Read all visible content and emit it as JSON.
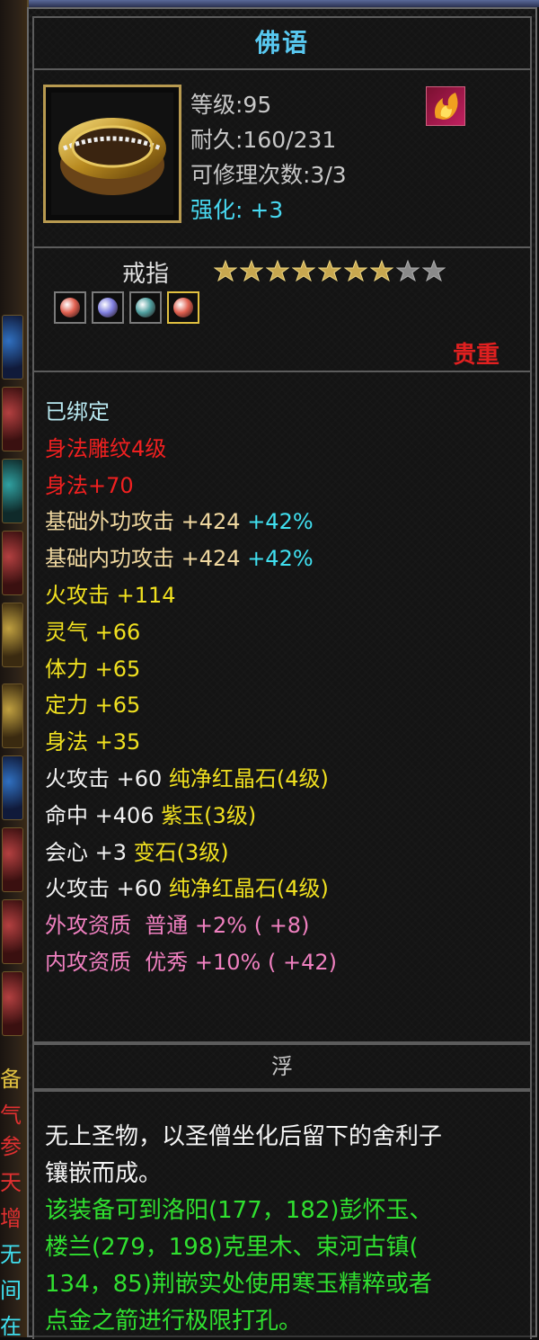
{
  "item": {
    "name": "佛语",
    "icon": "gold-ring-icon",
    "stats": {
      "level": "等级:95",
      "durability": "耐久:160/231",
      "repairs": "可修理次数:3/3",
      "strengthen_label": "强化:",
      "strengthen_value": "+3"
    },
    "badge_icon": "fire-element-icon",
    "type": "戒指",
    "stars": {
      "filled": 7,
      "total": 9
    },
    "gem_slots": [
      {
        "icon": "red-gem-icon",
        "color": "#e06050"
      },
      {
        "icon": "purple-gem-icon",
        "color": "#8080e0"
      },
      {
        "icon": "teal-gem-icon",
        "color": "#50a0a0"
      },
      {
        "icon": "red-gem-icon",
        "color": "#e06050"
      }
    ],
    "rarity": "贵重"
  },
  "attributes": [
    {
      "segs": [
        {
          "t": "已绑定",
          "c": "lightblue"
        }
      ]
    },
    {
      "segs": [
        {
          "t": "身法雕纹4级",
          "c": "red"
        }
      ]
    },
    {
      "segs": [
        {
          "t": "身法+70",
          "c": "red"
        }
      ]
    },
    {
      "segs": [
        {
          "t": "基础外功攻击 +424 ",
          "c": "orange"
        },
        {
          "t": "+42%",
          "c": "cyan"
        }
      ]
    },
    {
      "segs": [
        {
          "t": "基础内功攻击 +424 ",
          "c": "orange"
        },
        {
          "t": "+42%",
          "c": "cyan"
        }
      ]
    },
    {
      "segs": [
        {
          "t": "火攻击 +114",
          "c": "yellow"
        }
      ]
    },
    {
      "segs": [
        {
          "t": "灵气 +66",
          "c": "yellow"
        }
      ]
    },
    {
      "segs": [
        {
          "t": "体力 +65",
          "c": "yellow"
        }
      ]
    },
    {
      "segs": [
        {
          "t": "定力 +65",
          "c": "yellow"
        }
      ]
    },
    {
      "segs": [
        {
          "t": "身法 +35",
          "c": "yellow"
        }
      ]
    },
    {
      "segs": [
        {
          "t": "火攻击 +60 ",
          "c": "white"
        },
        {
          "t": "纯净红晶石(4级)",
          "c": "yellow"
        }
      ]
    },
    {
      "segs": [
        {
          "t": "命中 +406 ",
          "c": "white"
        },
        {
          "t": "紫玉(3级)",
          "c": "yellow"
        }
      ]
    },
    {
      "segs": [
        {
          "t": "会心 +3 ",
          "c": "white"
        },
        {
          "t": "变石(3级)",
          "c": "yellow"
        }
      ]
    },
    {
      "segs": [
        {
          "t": "火攻击 +60 ",
          "c": "white"
        },
        {
          "t": "纯净红晶石(4级)",
          "c": "yellow"
        }
      ]
    },
    {
      "segs": [
        {
          "t": "外攻资质  普通 +2% ( +8)",
          "c": "pink"
        }
      ]
    },
    {
      "segs": [
        {
          "t": "内攻资质  优秀 +10% ( +42)",
          "c": "pink"
        }
      ]
    }
  ],
  "float_label": "浮",
  "description": {
    "white_lines": [
      "无上圣物，以圣僧坐化后留下的舍利子",
      "镶嵌而成。"
    ],
    "green_lines": [
      "该装备可到洛阳(177，182)彭怀玉、",
      "楼兰(279，198)克里木、束河古镇(",
      "134，85)荆嵌实处使用寒玉精粹或者",
      "点金之箭进行极限打孔。"
    ]
  },
  "background_ui": {
    "strip_chars": [
      "备",
      "气",
      "参",
      "天",
      "增",
      "无",
      "间",
      "在"
    ]
  }
}
